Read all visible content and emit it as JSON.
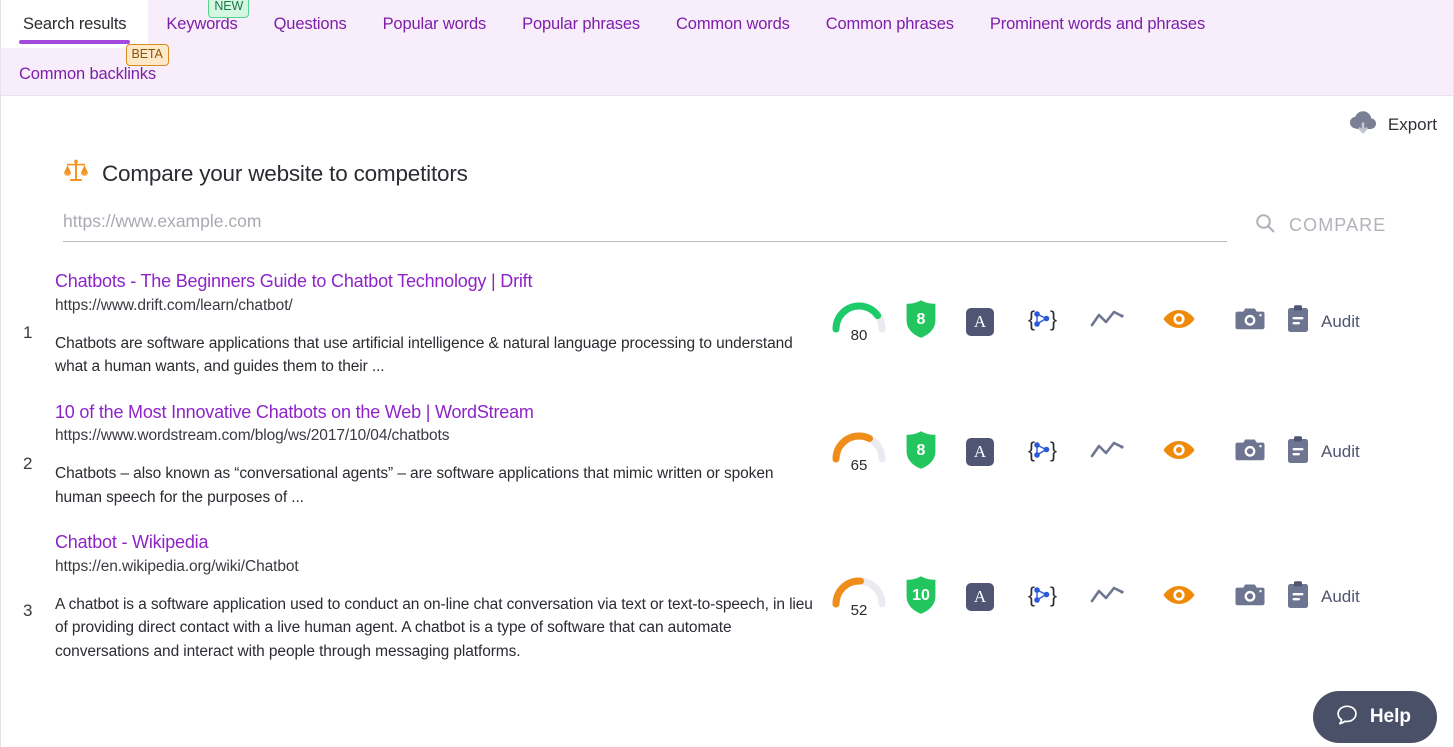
{
  "tabs_row1": [
    {
      "label": "Search results",
      "active": true,
      "badge": null
    },
    {
      "label": "Keywords",
      "active": false,
      "badge": "NEW"
    },
    {
      "label": "Questions",
      "active": false,
      "badge": null
    },
    {
      "label": "Popular words",
      "active": false,
      "badge": null
    },
    {
      "label": "Popular phrases",
      "active": false,
      "badge": null
    },
    {
      "label": "Common words",
      "active": false,
      "badge": null
    },
    {
      "label": "Common phrases",
      "active": false,
      "badge": null
    },
    {
      "label": "Prominent words and phrases",
      "active": false,
      "badge": null
    }
  ],
  "tabs_row2": [
    {
      "label": "Common backlinks",
      "active": false,
      "badge": "BETA"
    }
  ],
  "toolbar": {
    "export_label": "Export",
    "export_icon": "cloud-download-icon"
  },
  "compare": {
    "title": "Compare your website to competitors",
    "title_icon": "balance-scale-icon",
    "input_value": "",
    "input_placeholder": "https://www.example.com",
    "button_label": "COMPARE",
    "button_icon": "search-icon"
  },
  "metric_icons": {
    "gauge": "gauge-icon",
    "shield": "shield-icon",
    "authority": "authority-a-icon",
    "schema": "schema-braces-icon",
    "trend": "trend-line-icon",
    "visibility": "eye-icon",
    "screenshot": "camera-icon",
    "audit": "clipboard-icon"
  },
  "audit_label": "Audit",
  "results": [
    {
      "rank": "1",
      "title": "Chatbots - The Beginners Guide to Chatbot Technology | Drift",
      "url": "https://www.drift.com/learn/chatbot/",
      "snippet": "Chatbots are software applications that use artificial intelligence & natural language processing to understand what a human wants, and guides them to their ...",
      "gauge_value": "80",
      "gauge_color": "#1ecb6b",
      "shield_value": "8",
      "shield_color": "#22c55e"
    },
    {
      "rank": "2",
      "title": "10 of the Most Innovative Chatbots on the Web | WordStream",
      "url": "https://www.wordstream.com/blog/ws/2017/10/04/chatbots",
      "snippet": "Chatbots – also known as “conversational agents” – are software applications that mimic written or spoken human speech for the purposes of ...",
      "gauge_value": "65",
      "gauge_color": "#f08c1a",
      "shield_value": "8",
      "shield_color": "#22c55e"
    },
    {
      "rank": "3",
      "title": "Chatbot - Wikipedia",
      "url": "https://en.wikipedia.org/wiki/Chatbot",
      "snippet": "A chatbot is a software application used to conduct an on-line chat conversation via text or text-to-speech, in lieu of providing direct contact with a live human agent. A chatbot is a type of software that can automate conversations and interact with people through messaging platforms.",
      "gauge_value": "52",
      "gauge_color": "#f08c1a",
      "shield_value": "10",
      "shield_color": "#22c55e"
    }
  ],
  "help": {
    "label": "Help",
    "icon": "speech-bubble-icon"
  },
  "colors": {
    "tabbar_bg": "#f8eefb",
    "tab_link": "#7d1fa8",
    "accent_underline": "#a449dd",
    "result_title": "#8e24c8",
    "orange": "#f08c1a",
    "green": "#22c55e",
    "slate": "#4f5572"
  }
}
